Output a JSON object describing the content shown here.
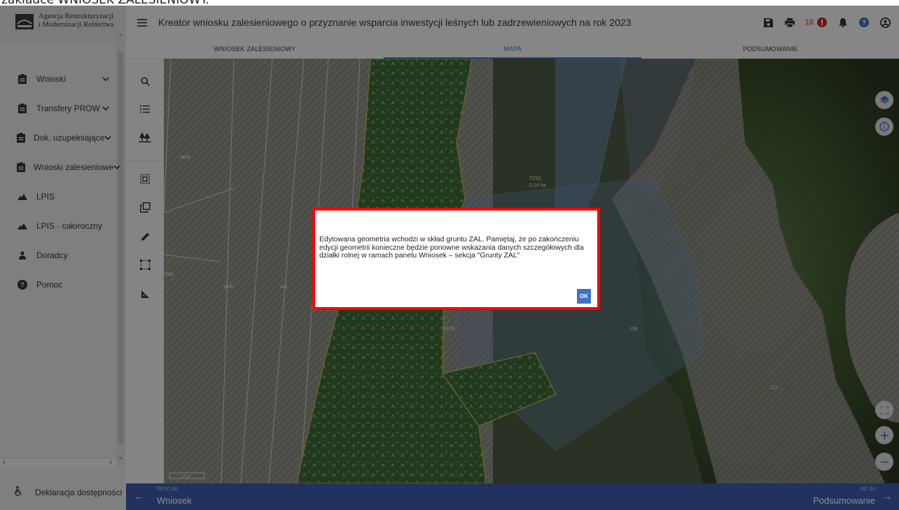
{
  "doc_text": "zakładce WNIOSEK ZALESIENIOWY.",
  "logo": {
    "line1": "Agencja Restrukturyzacji",
    "line2": "i Modernizacji Rolnictwa"
  },
  "sidebar": {
    "items": [
      {
        "label": "Wnioski",
        "icon": "clipboard-icon",
        "expandable": true
      },
      {
        "label": "Transfery PROW",
        "icon": "clipboard-icon",
        "expandable": true
      },
      {
        "label": "Dok. uzupełniające",
        "icon": "clipboard-icon",
        "expandable": true
      },
      {
        "label": "Wnioski zalesieniowe",
        "icon": "clipboard-icon",
        "expandable": true
      },
      {
        "label": "LPIS",
        "icon": "mountain-icon",
        "expandable": false
      },
      {
        "label": "LPIS - całoroczny",
        "icon": "mountain-icon",
        "expandable": false
      },
      {
        "label": "Doradcy",
        "icon": "person-icon",
        "expandable": false
      },
      {
        "label": "Pomoc",
        "icon": "help-icon",
        "expandable": false
      }
    ],
    "footer": "Deklaracja dostępności"
  },
  "header": {
    "title": "Kreator wniosku zalesieniowego o przyznanie wsparcia inwestycji leśnych lub zadrzewieniowych na rok 2023",
    "error_count": "18",
    "accent": "#3f6fbf"
  },
  "tabs": [
    {
      "label": "WNIOSEK ZALESIENIOWY",
      "active": false
    },
    {
      "label": "MAPA",
      "active": true
    },
    {
      "label": "PODSUMOWANIE",
      "active": false
    }
  ],
  "map": {
    "parcel_labels": [
      "98/3",
      "98/4",
      "98/8",
      "101",
      "109",
      "110",
      "A104"
    ],
    "tzs_label": "TZS1",
    "tzs_area": "0,24 ha",
    "scale": "10 m"
  },
  "dialog": {
    "message": "Edytowana geometria wchodzi w skład gruntu ZAL. Pamiętaj, że po zakończeniu edycji geometrii konieczne będzie ponowne wskazania danych szczegółowych dla działki rolnej w ramach panelu Wniosek – sekcja \"Grunty ZAL\"",
    "ok_label": "OK",
    "outline_color": "#ff0000"
  },
  "bottom_nav": {
    "back_small": "Wróć do",
    "back_big": "Wniosek",
    "next_small": "Idź do",
    "next_big": "Podsumowanie"
  }
}
